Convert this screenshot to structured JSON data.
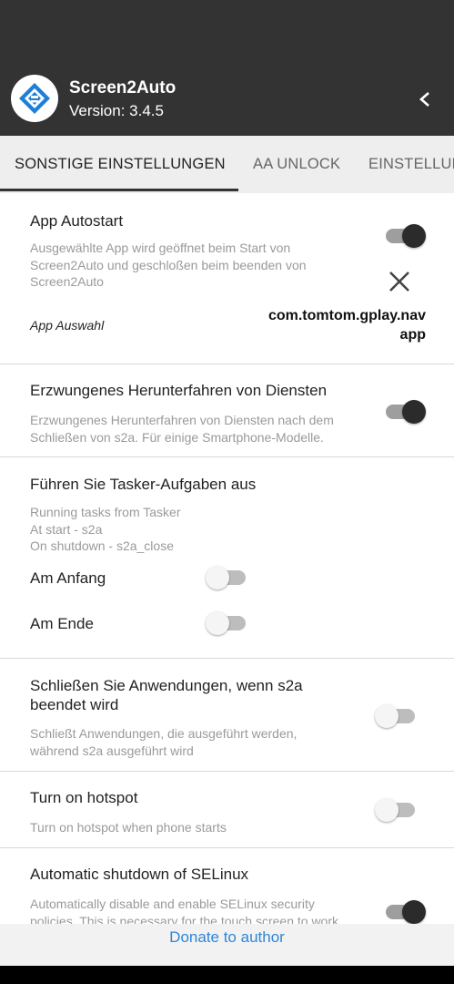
{
  "app": {
    "title": "Screen2Auto",
    "version": "Version: 3.4.5"
  },
  "tabs": [
    {
      "label": "SONSTIGE EINSTELLUNGEN",
      "active": true
    },
    {
      "label": "AA UNLOCK",
      "active": false
    },
    {
      "label": "EINSTELLUNGEN",
      "active": false
    }
  ],
  "sections": {
    "autostart": {
      "title": "App Autostart",
      "desc_lines": [
        "Ausgewählte App wird geöffnet beim Start von",
        "Screen2Auto und geschloßen beim beenden von",
        "Screen2Auto"
      ],
      "enabled": true,
      "app_label": "App Auswahl",
      "app_value_lines": [
        "com.tomtom.gplay.nav",
        "app"
      ]
    },
    "forced_shutdown": {
      "title": "Erzwungenes Herunterfahren von Diensten",
      "desc_lines": [
        "Erzwungenes Herunterfahren von Diensten nach dem",
        "Schließen von s2a. Für einige Smartphone-Modelle."
      ],
      "enabled": true
    },
    "tasker": {
      "title": "Führen Sie Tasker-Aufgaben aus",
      "desc_lines": [
        "Running tasks from Tasker",
        "At start - s2a",
        "On shutdown - s2a_close"
      ],
      "at_start_label": "Am Anfang",
      "at_start_enabled": false,
      "at_end_label": "Am Ende",
      "at_end_enabled": false
    },
    "close_apps": {
      "title_lines": [
        "Schließen Sie Anwendungen, wenn s2a",
        "beendet wird"
      ],
      "desc_lines": [
        "Schließt Anwendungen, die ausgeführt werden,",
        "während s2a ausgeführt wird"
      ],
      "enabled": false
    },
    "hotspot": {
      "title": "Turn on hotspot",
      "desc": "Turn on hotspot when phone starts",
      "enabled": false
    },
    "selinux": {
      "title": "Automatic shutdown of SELinux",
      "desc_lines": [
        "Automatically disable and enable SELinux security",
        "policies. This is necessary for the touch screen to work"
      ],
      "enabled": true
    }
  },
  "footer": {
    "donate_label": "Donate to author"
  },
  "colors": {
    "header_bg": "#333333",
    "tab_bg": "#eeeeee",
    "link": "#2f86d8",
    "logo_blue": "#1e7fd6"
  },
  "icons": {
    "logo": "screen2auto-logo",
    "back": "chevron-left-icon",
    "clear": "close-icon"
  }
}
